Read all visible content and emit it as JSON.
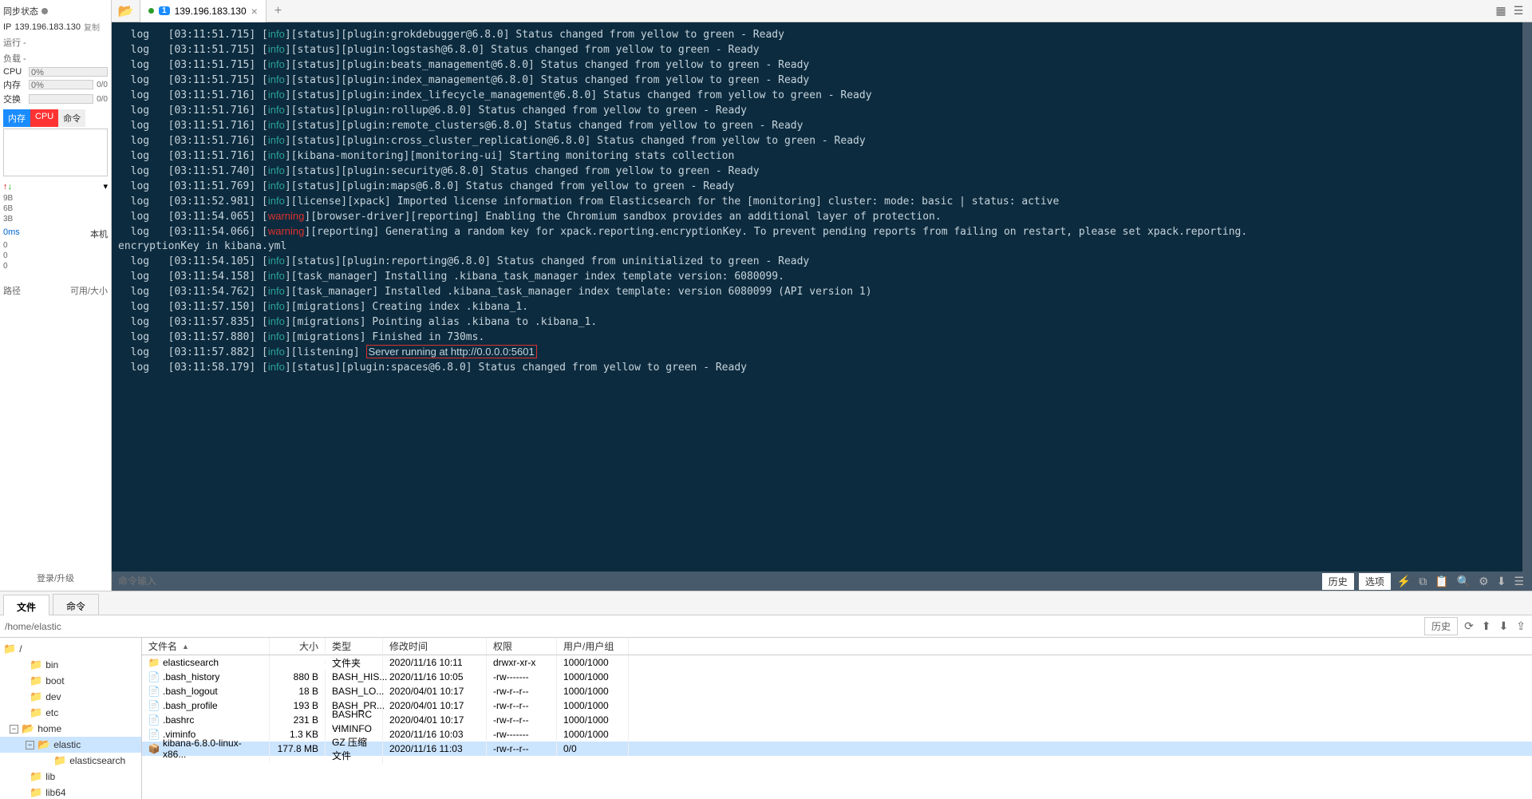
{
  "sidebar": {
    "sync_status": "同步状态",
    "ip_label": "IP",
    "ip": "139.196.183.130",
    "copy": "复制",
    "run": "运行 -",
    "load": "负载 -",
    "cpu_label": "CPU",
    "cpu_val": "0%",
    "mem_label": "内存",
    "mem_val": "0%",
    "mem_ratio": "0/0",
    "swap_label": "交换",
    "swap_ratio": "0/0",
    "tab_mem": "内存",
    "tab_cpu": "CPU",
    "tab_cmd": "命令",
    "net_vals": [
      "9B",
      "6B",
      "3B"
    ],
    "ms": "0ms",
    "local": "本机",
    "zeros": [
      "0",
      "0",
      "0"
    ],
    "path_label": "路径",
    "size_label": "可用/大小",
    "login": "登录/升级"
  },
  "tab": {
    "num": "1",
    "title": "139.196.183.130"
  },
  "logs": [
    {
      "t": "03:11:51.715",
      "lvl": "info",
      "txt": "[status][plugin:grokdebugger@6.8.0] Status changed from yellow to green - Ready"
    },
    {
      "t": "03:11:51.715",
      "lvl": "info",
      "txt": "[status][plugin:logstash@6.8.0] Status changed from yellow to green - Ready"
    },
    {
      "t": "03:11:51.715",
      "lvl": "info",
      "txt": "[status][plugin:beats_management@6.8.0] Status changed from yellow to green - Ready"
    },
    {
      "t": "03:11:51.715",
      "lvl": "info",
      "txt": "[status][plugin:index_management@6.8.0] Status changed from yellow to green - Ready"
    },
    {
      "t": "03:11:51.716",
      "lvl": "info",
      "txt": "[status][plugin:index_lifecycle_management@6.8.0] Status changed from yellow to green - Ready"
    },
    {
      "t": "03:11:51.716",
      "lvl": "info",
      "txt": "[status][plugin:rollup@6.8.0] Status changed from yellow to green - Ready"
    },
    {
      "t": "03:11:51.716",
      "lvl": "info",
      "txt": "[status][plugin:remote_clusters@6.8.0] Status changed from yellow to green - Ready"
    },
    {
      "t": "03:11:51.716",
      "lvl": "info",
      "txt": "[status][plugin:cross_cluster_replication@6.8.0] Status changed from yellow to green - Ready"
    },
    {
      "t": "03:11:51.716",
      "lvl": "info",
      "txt": "[kibana-monitoring][monitoring-ui] Starting monitoring stats collection"
    },
    {
      "t": "03:11:51.740",
      "lvl": "info",
      "txt": "[status][plugin:security@6.8.0] Status changed from yellow to green - Ready"
    },
    {
      "t": "03:11:51.769",
      "lvl": "info",
      "txt": "[status][plugin:maps@6.8.0] Status changed from yellow to green - Ready"
    },
    {
      "t": "03:11:52.981",
      "lvl": "info",
      "txt": "[license][xpack] Imported license information from Elasticsearch for the [monitoring] cluster: mode: basic | status: active"
    },
    {
      "t": "03:11:54.065",
      "lvl": "warning",
      "txt": "[browser-driver][reporting] Enabling the Chromium sandbox provides an additional layer of protection."
    },
    {
      "t": "03:11:54.066",
      "lvl": "warning",
      "txt": "[reporting] Generating a random key for xpack.reporting.encryptionKey. To prevent pending reports from failing on restart, please set xpack.reporting.encryptionKey in kibana.yml",
      "wrap": true
    },
    {
      "t": "03:11:54.105",
      "lvl": "info",
      "txt": "[status][plugin:reporting@6.8.0] Status changed from uninitialized to green - Ready"
    },
    {
      "t": "03:11:54.158",
      "lvl": "info",
      "txt": "[task_manager] Installing .kibana_task_manager index template version: 6080099."
    },
    {
      "t": "03:11:54.762",
      "lvl": "info",
      "txt": "[task_manager] Installed .kibana_task_manager index template: version 6080099 (API version 1)"
    },
    {
      "t": "03:11:57.150",
      "lvl": "info",
      "txt": "[migrations] Creating index .kibana_1."
    },
    {
      "t": "03:11:57.835",
      "lvl": "info",
      "txt": "[migrations] Pointing alias .kibana to .kibana_1."
    },
    {
      "t": "03:11:57.880",
      "lvl": "info",
      "txt": "[migrations] Finished in 730ms."
    },
    {
      "t": "03:11:57.882",
      "lvl": "info",
      "txt": "[listening] ",
      "hl": "Server running at http://0.0.0.0:5601"
    },
    {
      "t": "03:11:58.179",
      "lvl": "info",
      "txt": "[status][plugin:spaces@6.8.0] Status changed from yellow to green - Ready"
    }
  ],
  "cmdbar": {
    "placeholder": "命令输入",
    "history": "历史",
    "options": "选项"
  },
  "bottabs": {
    "files": "文件",
    "cmd": "命令"
  },
  "pathrow": {
    "path": "/home/elastic",
    "history": "历史"
  },
  "tree": {
    "root": "/",
    "items": [
      "bin",
      "boot",
      "dev",
      "etc",
      "home",
      "lib",
      "lib64"
    ],
    "home_children": [
      "elastic"
    ],
    "elastic_children": [
      "elasticsearch"
    ]
  },
  "cols": {
    "name": "文件名",
    "size": "大小",
    "type": "类型",
    "mtime": "修改时间",
    "perm": "权限",
    "owner": "用户/用户组"
  },
  "files": [
    {
      "icon": "folder",
      "name": "elasticsearch",
      "size": "",
      "type": "文件夹",
      "mtime": "2020/11/16 10:11",
      "perm": "drwxr-xr-x",
      "owner": "1000/1000"
    },
    {
      "icon": "file",
      "name": ".bash_history",
      "size": "880 B",
      "type": "BASH_HIS...",
      "mtime": "2020/11/16 10:05",
      "perm": "-rw-------",
      "owner": "1000/1000"
    },
    {
      "icon": "file",
      "name": ".bash_logout",
      "size": "18 B",
      "type": "BASH_LO...",
      "mtime": "2020/04/01 10:17",
      "perm": "-rw-r--r--",
      "owner": "1000/1000"
    },
    {
      "icon": "file",
      "name": ".bash_profile",
      "size": "193 B",
      "type": "BASH_PR...",
      "mtime": "2020/04/01 10:17",
      "perm": "-rw-r--r--",
      "owner": "1000/1000"
    },
    {
      "icon": "file",
      "name": ".bashrc",
      "size": "231 B",
      "type": "BASHRC ...",
      "mtime": "2020/04/01 10:17",
      "perm": "-rw-r--r--",
      "owner": "1000/1000"
    },
    {
      "icon": "file",
      "name": ".viminfo",
      "size": "1.3 KB",
      "type": "VIMINFO ...",
      "mtime": "2020/11/16 10:03",
      "perm": "-rw-------",
      "owner": "1000/1000"
    },
    {
      "icon": "archive",
      "name": "kibana-6.8.0-linux-x86...",
      "size": "177.8 MB",
      "type": "GZ 压缩文件",
      "mtime": "2020/11/16 11:03",
      "perm": "-rw-r--r--",
      "owner": "0/0",
      "sel": true
    }
  ]
}
